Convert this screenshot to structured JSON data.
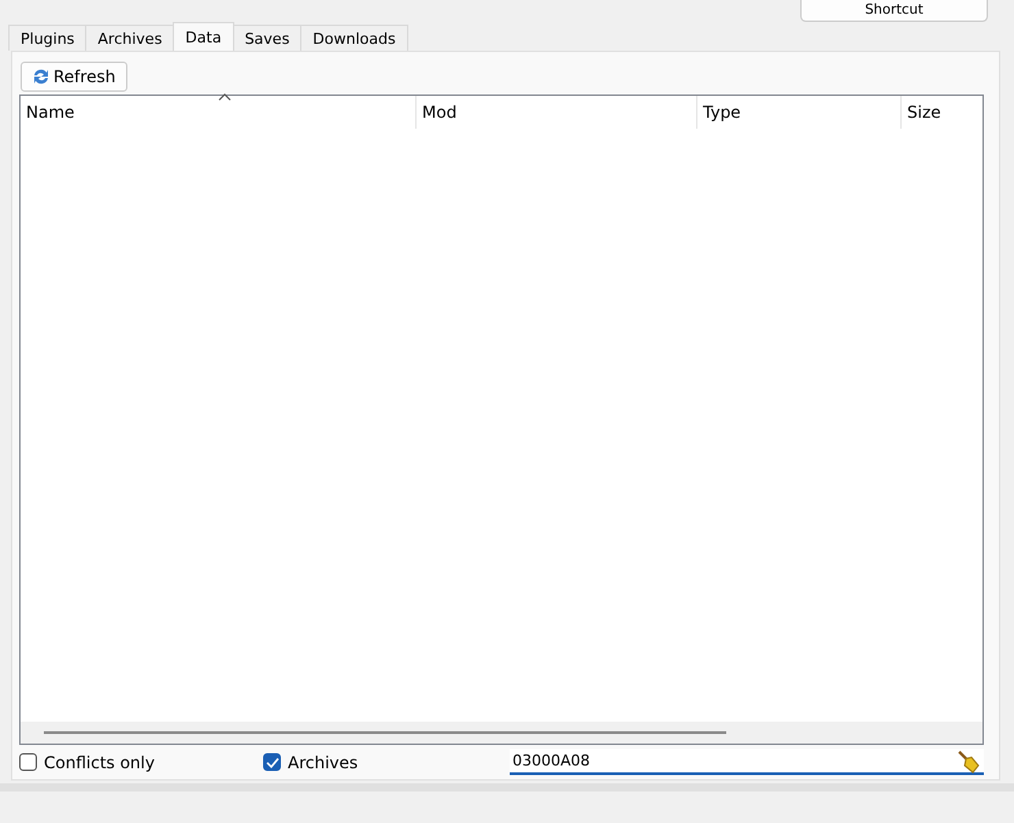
{
  "top_button": {
    "label": "Shortcut"
  },
  "tabs": [
    {
      "label": "Plugins",
      "selected": false
    },
    {
      "label": "Archives",
      "selected": false
    },
    {
      "label": "Data",
      "selected": true
    },
    {
      "label": "Saves",
      "selected": false
    },
    {
      "label": "Downloads",
      "selected": false
    }
  ],
  "refresh_button": {
    "label": "Refresh"
  },
  "table": {
    "columns": [
      {
        "label": "Name",
        "sorted": true
      },
      {
        "label": "Mod",
        "sorted": false
      },
      {
        "label": "Type",
        "sorted": false
      },
      {
        "label": "Size",
        "sorted": false
      }
    ]
  },
  "options": [
    {
      "label": "Conflicts only",
      "checked": false
    },
    {
      "label": "Archives",
      "checked": true
    }
  ],
  "filter": {
    "value": "03000A08"
  }
}
